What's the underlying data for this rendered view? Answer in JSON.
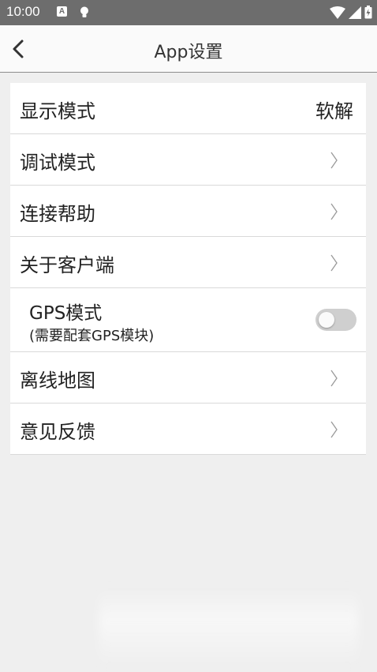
{
  "status_bar": {
    "time": "10:00",
    "icons": [
      "a-notification-icon",
      "bulb-icon",
      "wifi-icon",
      "signal-icon",
      "battery-icon"
    ],
    "notif_letter": "A"
  },
  "app_bar": {
    "title": "App设置",
    "back_icon": "chevron-left-icon"
  },
  "settings": {
    "display_mode": {
      "label": "显示模式",
      "value": "软解"
    },
    "debug_mode": {
      "label": "调试模式"
    },
    "connect_help": {
      "label": "连接帮助"
    },
    "about_client": {
      "label": "关于客户端"
    },
    "gps_mode": {
      "label": "GPS模式",
      "sublabel": "(需要配套GPS模块)",
      "enabled": false
    },
    "offline_map": {
      "label": "离线地图"
    },
    "feedback": {
      "label": "意见反馈"
    }
  },
  "colors": {
    "status_bar": "#6d6d6d",
    "background": "#efefef",
    "card": "#ffffff",
    "toggle_off": "#cfcfcf"
  }
}
